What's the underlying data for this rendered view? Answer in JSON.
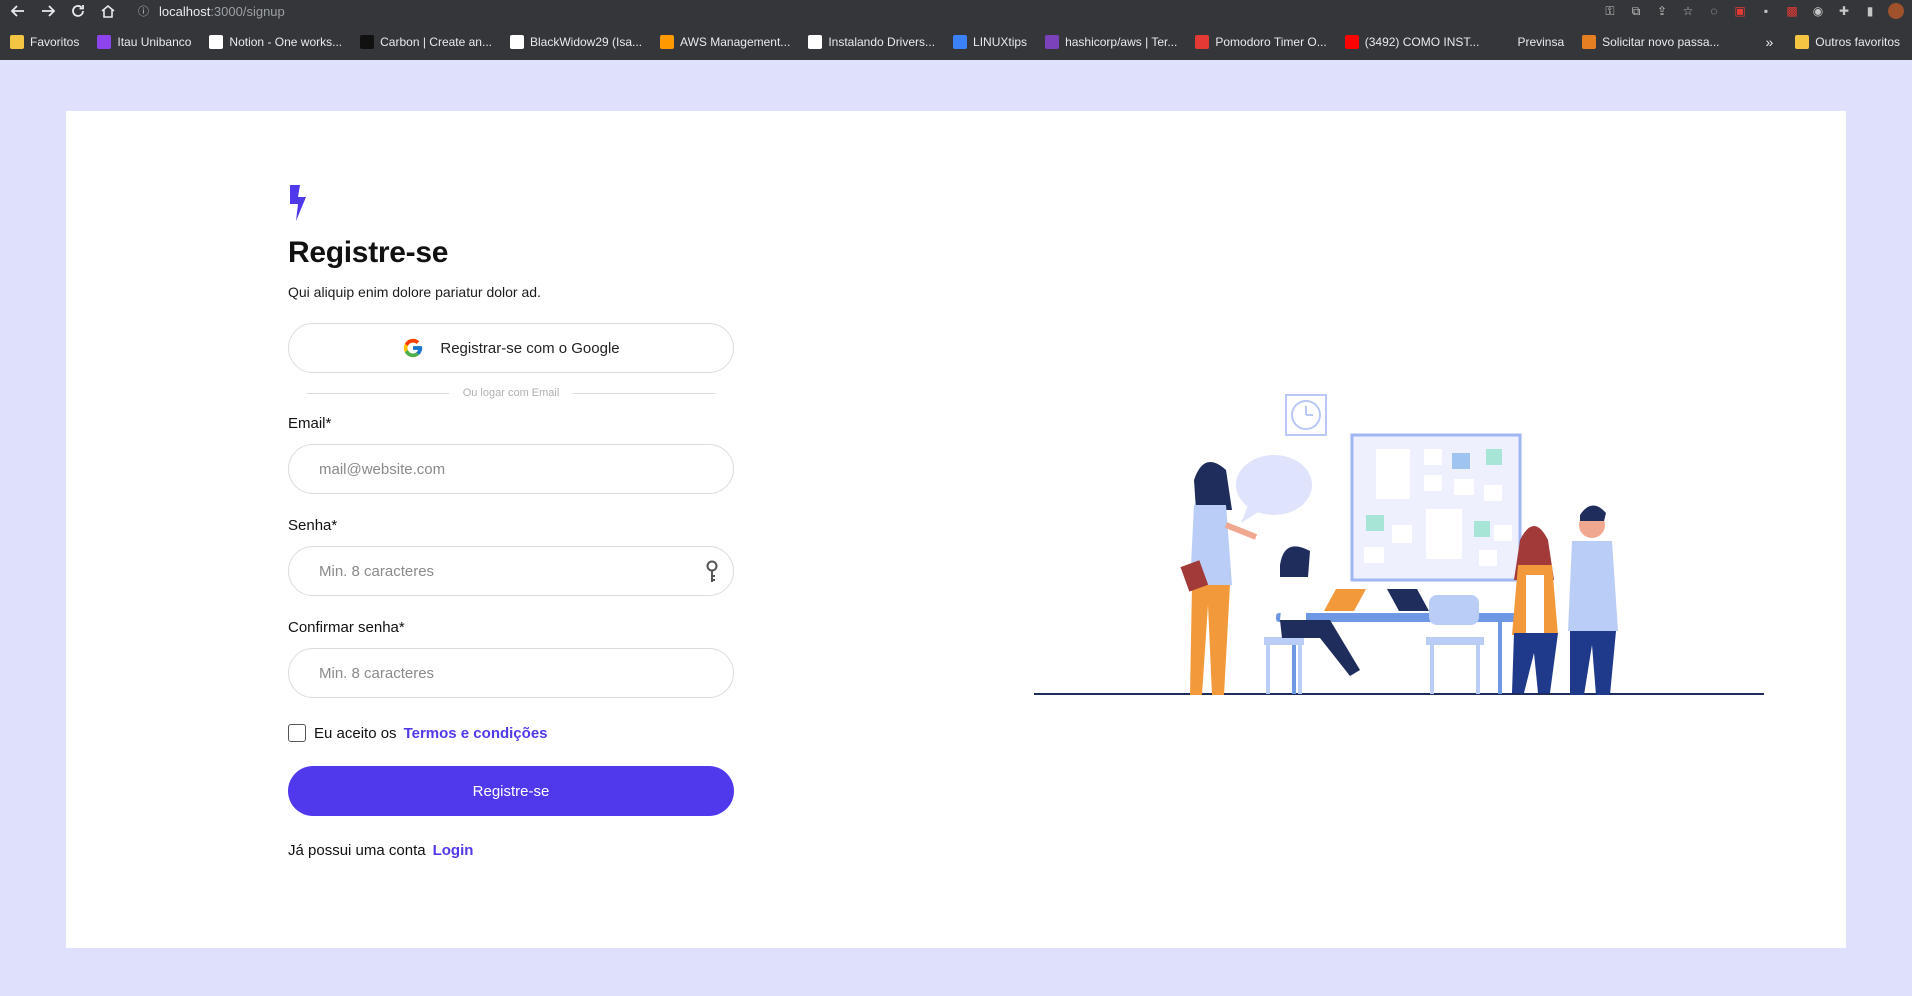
{
  "browser": {
    "url_host": "localhost",
    "url_path": ":3000/signup",
    "bookmarks": [
      {
        "label": "Favoritos",
        "icon": "folder-icon",
        "color": "#f4c542"
      },
      {
        "label": "Itau Unibanco",
        "icon": "itau-icon",
        "color": "#8e44ec"
      },
      {
        "label": "Notion - One works...",
        "icon": "notion-icon",
        "color": "#ffffff"
      },
      {
        "label": "Carbon | Create an...",
        "icon": "carbon-icon",
        "color": "#111111"
      },
      {
        "label": "BlackWidow29 (Isa...",
        "icon": "github-icon",
        "color": "#ffffff"
      },
      {
        "label": "AWS Management...",
        "icon": "aws-icon",
        "color": "#ff9900"
      },
      {
        "label": "Instalando Drivers...",
        "icon": "tux-icon",
        "color": "#ffffff"
      },
      {
        "label": "LINUXtips",
        "icon": "linuxtips-icon",
        "color": "#3b82f6"
      },
      {
        "label": "hashicorp/aws | Ter...",
        "icon": "terraform-icon",
        "color": "#7b42bc"
      },
      {
        "label": "Pomodoro Timer O...",
        "icon": "pomodoro-icon",
        "color": "#e53935"
      },
      {
        "label": "(3492) COMO INST...",
        "icon": "youtube-icon",
        "color": "#ff0000"
      },
      {
        "label": "Previnsa",
        "icon": "blank-icon",
        "color": "#35363a"
      },
      {
        "label": "Solicitar novo passa...",
        "icon": "gear-orange-icon",
        "color": "#e67e22"
      }
    ],
    "more_label": "»",
    "other_favorites": "Outros favoritos"
  },
  "form": {
    "title": "Registre-se",
    "subtitle": "Qui aliquip enim dolore pariatur dolor ad.",
    "google_button": "Registrar-se com o Google",
    "divider_text": "Ou logar com Email",
    "email_label": "Email*",
    "email_placeholder": "mail@website.com",
    "password_label": "Senha*",
    "password_placeholder": "Min. 8 caracteres",
    "confirm_label": "Confirmar senha*",
    "confirm_placeholder": "Min. 8 caracteres",
    "terms_prefix": "Eu aceito os",
    "terms_link": "Termos e condições",
    "submit": "Registre-se",
    "login_prefix": "Já possui uma conta",
    "login_link": "Login"
  },
  "colors": {
    "accent": "#5038ed",
    "page_bg": "#dfe0fb"
  }
}
